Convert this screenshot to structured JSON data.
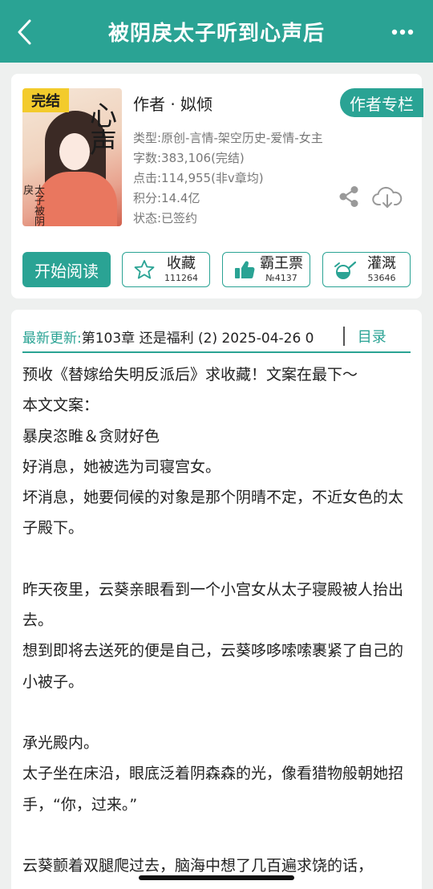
{
  "header": {
    "title": "被阴戾太子听到心声后"
  },
  "book": {
    "cover": {
      "tag": "完结",
      "calligraphy": "心声",
      "vertical_title": "太子被阴戾"
    },
    "author_line": "作者 · 姒倾",
    "author_column_label": "作者专栏",
    "meta": [
      "类型:原创-言情-架空历史-爱情-女主",
      "字数:383,106(完结)",
      "点击:114,955(非v章均)",
      "积分:14.4亿",
      "状态:已签约"
    ]
  },
  "actions": {
    "read_label": "开始阅读",
    "favorite": {
      "label": "收藏",
      "count": "111264"
    },
    "vote": {
      "label": "霸王票",
      "count": "№4137"
    },
    "irrigate": {
      "label": "灌溉",
      "count": "53646"
    }
  },
  "latest": {
    "label": "最新更新:",
    "value": "第103章 还是福利 (2) 2025-04-26 0",
    "toc_label": "目录"
  },
  "description": [
    "预收《替嫁给失明反派后》求收藏！文案在最下～",
    "本文文案：",
    "暴戾恣睢＆贪财好色",
    "好消息，她被选为司寝宫女。",
    "坏消息，她要伺候的对象是那个阴晴不定，不近女色的太子殿下。",
    "",
    "昨天夜里，云葵亲眼看到一个小宫女从太子寝殿被人抬出去。",
    "想到即将去送死的便是自己，云葵哆哆嗦嗦裹紧了自己的小被子。",
    "",
    "承光殿内。",
    "太子坐在床沿，眼底泛着阴森森的光，像看猎物般朝她招手，“你，过来。”",
    "",
    "云葵颤着双腿爬过去，脑海中想了几百遍求饶的话，"
  ],
  "colors": {
    "accent": "#2aa394",
    "cover_tag": "#f3cb2c",
    "background": "#eef0ef"
  }
}
